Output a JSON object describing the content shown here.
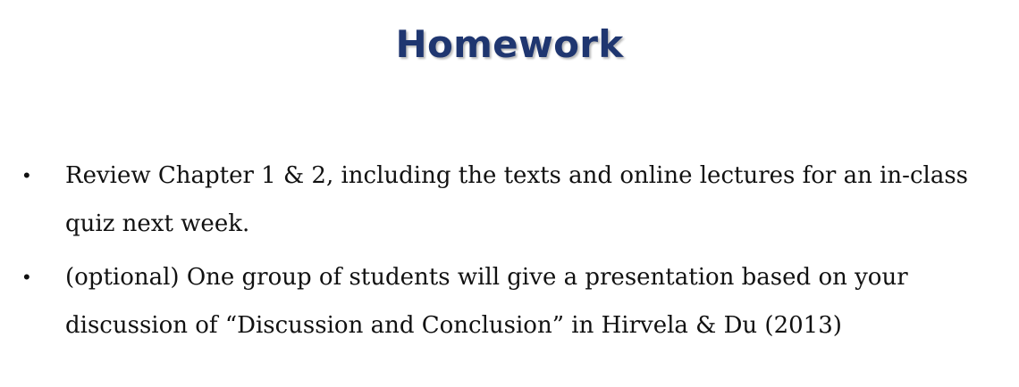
{
  "slide": {
    "title": "Homework",
    "title_color": "#1f3670",
    "bullets": [
      {
        "marker": "•",
        "text": "Review Chapter 1 & 2, including the texts and online lectures for an in-class quiz next week."
      },
      {
        "marker": "•",
        "text": "(optional) One group of students will give a presentation based on your discussion of “Discussion and Conclusion” in Hirvela & Du (2013)"
      }
    ]
  }
}
